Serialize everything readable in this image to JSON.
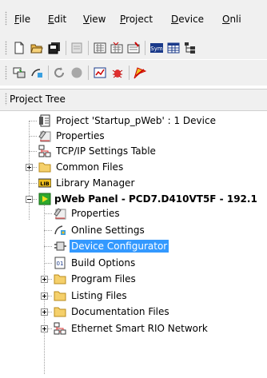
{
  "menu": [
    {
      "label": "File",
      "underline": "F",
      "rest": "ile"
    },
    {
      "label": "Edit",
      "underline": "E",
      "rest": "dit"
    },
    {
      "label": "View",
      "underline": "V",
      "rest": "iew"
    },
    {
      "label": "Project",
      "underline": "P",
      "rest": "roject"
    },
    {
      "label": "Device",
      "underline": "D",
      "rest": "evice"
    },
    {
      "label": "Onli",
      "underline": "O",
      "rest": "nli"
    }
  ],
  "toolbar1": [
    "new-file-icon",
    "open-folder-icon",
    "save-all-icon",
    "properties-icon",
    "build-icon",
    "rebuild-icon",
    "clean-icon",
    "symbol-editor-icon",
    "table-icon",
    "tree-icon"
  ],
  "toolbar2": [
    "download-icon",
    "online-settings-icon",
    "go-online-icon",
    "stop-icon",
    "diagnostics-icon",
    "bug-icon",
    "flag-icon"
  ],
  "panel": {
    "title": "Project Tree"
  },
  "tree": [
    {
      "label": "Project 'Startup_pWeb' : 1 Device",
      "icon": "project-icon"
    },
    {
      "label": "Properties",
      "icon": "properties-icon"
    },
    {
      "label": "TCP/IP Settings Table",
      "icon": "network-icon"
    },
    {
      "label": "Common Files",
      "icon": "folder-icon"
    },
    {
      "label": "Library Manager",
      "icon": "library-icon"
    },
    {
      "label": "pWeb Panel - PCD7.D410VT5F - 192.1",
      "icon": "device-icon"
    },
    {
      "label": "Properties",
      "icon": "properties-icon"
    },
    {
      "label": "Online Settings",
      "icon": "online-settings-icon"
    },
    {
      "label": "Device Configurator",
      "icon": "configurator-icon"
    },
    {
      "label": "Build Options",
      "icon": "build-options-icon"
    },
    {
      "label": "Program Files",
      "icon": "folder-icon"
    },
    {
      "label": "Listing Files",
      "icon": "folder-icon"
    },
    {
      "label": "Documentation Files",
      "icon": "folder-icon"
    },
    {
      "label": "Ethernet Smart RIO Network",
      "icon": "network-icon"
    }
  ],
  "colors": {
    "selection": "#3399ff",
    "folder": "#f5d06b",
    "device": "#2ea82e"
  }
}
